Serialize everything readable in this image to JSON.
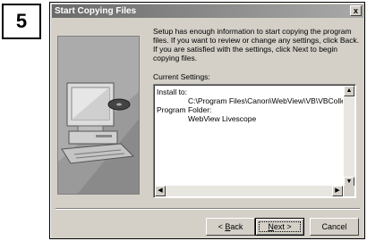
{
  "step_number": "5",
  "window": {
    "title": "Start Copying Files",
    "close_glyph": "x"
  },
  "intro_text": "Setup has enough information to start copying the program files. If you want to review or change any settings, click Back.  If you are satisfied with the settings, click Next to begin copying files.",
  "settings": {
    "label": "Current Settings:",
    "lines": [
      {
        "text": "Install to:",
        "indent": false
      },
      {
        "text": "C:\\Program Files\\Canon\\WebView\\VB\\VBCollector",
        "indent": true
      },
      {
        "text": "Program Folder:",
        "indent": false
      },
      {
        "text": "WebView Livescope",
        "indent": true
      }
    ]
  },
  "buttons": {
    "back": {
      "prefix": "< ",
      "underlined": "B",
      "rest": "ack"
    },
    "next": {
      "underlined": "N",
      "rest": "ext >"
    },
    "cancel": "Cancel"
  },
  "scroll_glyphs": {
    "up": "▲",
    "down": "▼",
    "left": "◀",
    "right": "▶"
  },
  "icons": [
    "computer-illustration",
    "close-icon"
  ]
}
